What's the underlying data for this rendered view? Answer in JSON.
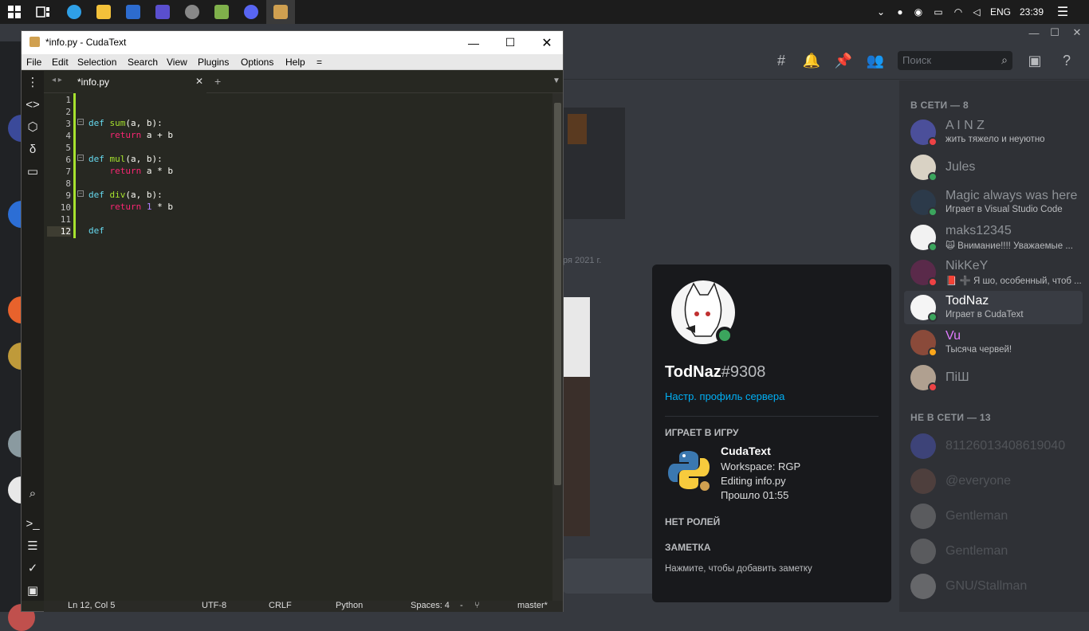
{
  "taskbar": {
    "apps": [
      {
        "name": "start",
        "color": "#ffffff"
      },
      {
        "name": "task-view",
        "color": "#cccccc"
      },
      {
        "name": "edge",
        "color": "#2fa0e7"
      },
      {
        "name": "explorer",
        "color": "#f3c13a"
      },
      {
        "name": "powershell",
        "color": "#2d6ccf"
      },
      {
        "name": "app-t",
        "color": "#5a4fcf"
      },
      {
        "name": "app-cat",
        "color": "#888888"
      },
      {
        "name": "notepad",
        "color": "#7fb04b"
      },
      {
        "name": "discord",
        "color": "#5865f2"
      },
      {
        "name": "cudatext",
        "color": "#d0a050"
      }
    ],
    "lang": "ENG",
    "clock": "23:39"
  },
  "cuda": {
    "title": "*info.py - CudaText",
    "menu": [
      "File",
      "Edit",
      "Selection",
      "Search",
      "View",
      "Plugins",
      "Options",
      "Help",
      "="
    ],
    "tab_label": "*info.py",
    "lines": [
      "1",
      "2",
      "3",
      "4",
      "5",
      "6",
      "7",
      "8",
      "9",
      "10",
      "11",
      "12"
    ],
    "status": {
      "pos": "Ln 12, Col 5",
      "enc": "UTF-8",
      "eol": "CRLF",
      "lexer": "Python",
      "tabs": "Spaces: 4",
      "dash": "-",
      "branch": "master*"
    }
  },
  "discord": {
    "search_placeholder": "Поиск",
    "chat_date": "ря 2021 г.",
    "online_header": "В СЕТИ — 8",
    "offline_header": "НЕ В СЕТИ — 13",
    "members_online": [
      {
        "name": "A I N Z",
        "sub": "жить тяжело и неуютно",
        "name_color": "#8e9297",
        "avatar": "#4b4f9a",
        "status": "#ed4245"
      },
      {
        "name": "Jules",
        "sub": "",
        "name_color": "#8e9297",
        "avatar": "#d9d2c4",
        "status": "#3ba55d"
      },
      {
        "name": "Magic always was here",
        "sub": "Играет в Visual Studio Code",
        "name_color": "#8e9297",
        "avatar": "#2c3a4a",
        "status": "#3ba55d"
      },
      {
        "name": "maks12345",
        "sub": "🙀 Внимание!!!! Уважаемые ...",
        "name_color": "#8e9297",
        "avatar": "#f2f2f2",
        "status": "#3ba55d"
      },
      {
        "name": "NikKeY",
        "sub": "📕 ➕ Я шо, особенный, чтоб ...",
        "name_color": "#8e9297",
        "avatar": "#5a2a4a",
        "status": "#ed4245"
      },
      {
        "name": "TodNaz",
        "sub": "Играет в CudaText",
        "name_color": "#ffffff",
        "avatar": "#f5f5f5",
        "status": "#3ba55d"
      },
      {
        "name": "Vu",
        "sub": "Тысяча червей!",
        "name_color": "#e07bff",
        "avatar": "#8a4a3a",
        "status": "#faa61a"
      },
      {
        "name": "ПіШ",
        "sub": "",
        "name_color": "#8e9297",
        "avatar": "#b0a090",
        "status": "#ed4245"
      }
    ],
    "members_offline": [
      {
        "name": "81126013408619040",
        "avatar": "#5865f2"
      },
      {
        "name": "@everyone",
        "avatar": "#8a5a4a"
      },
      {
        "name": "Gentleman",
        "avatar": "#aaaaaa"
      },
      {
        "name": "Gentleman",
        "avatar": "#aaaaaa"
      },
      {
        "name": "GNU/Stallman",
        "avatar": "#cccccc"
      }
    ],
    "popout": {
      "username": "TodNaz",
      "tag": "#9308",
      "server_profile_link": "Настр. профиль сервера",
      "playing_header": "ИГРАЕТ В ИГРУ",
      "game_name": "CudaText",
      "game_details": [
        "Workspace: RGP",
        "Editing info.py",
        "Прошло 01:55"
      ],
      "roles_header": "НЕТ РОЛЕЙ",
      "note_header": "ЗАМЕТКА",
      "note_placeholder": "Нажмите, чтобы добавить заметку"
    }
  }
}
